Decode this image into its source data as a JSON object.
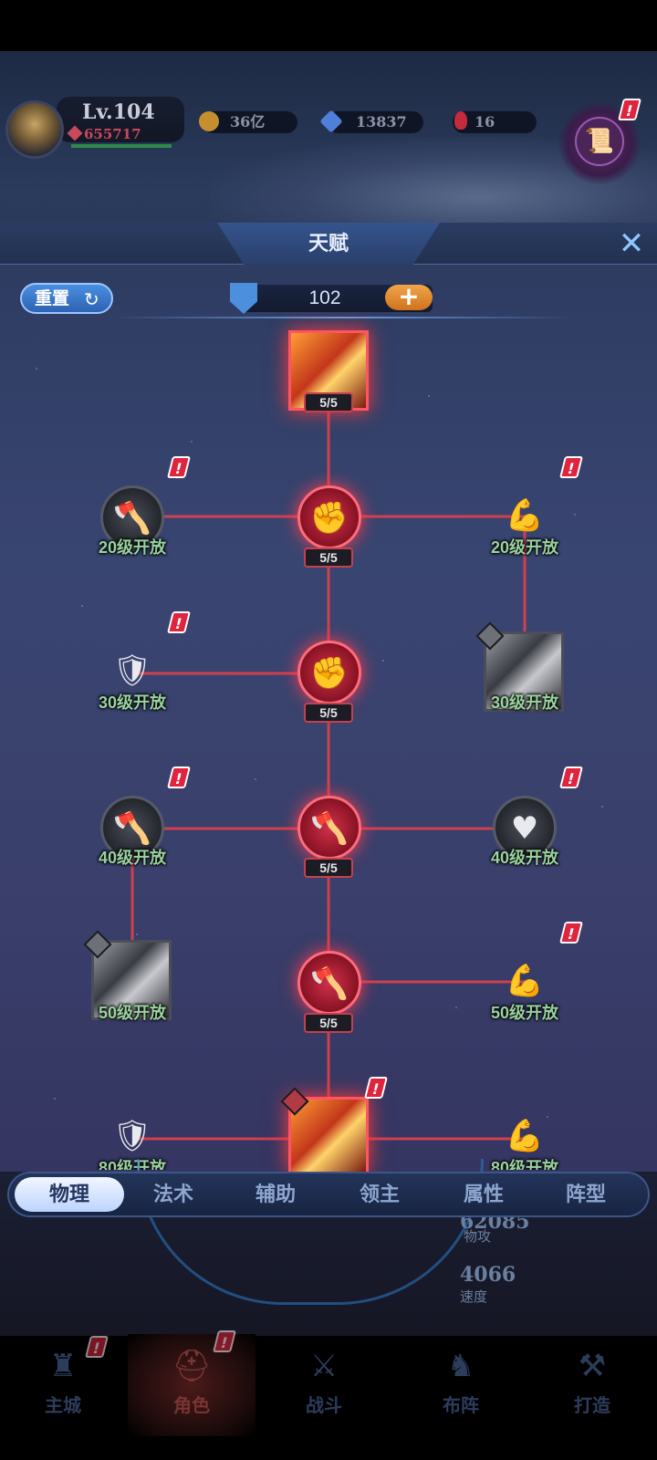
{
  "header": {
    "level": "Lv.104",
    "power": "655717",
    "resources": [
      {
        "name": "gold",
        "value": "36亿",
        "color": "#d4a13c"
      },
      {
        "name": "diamond",
        "value": "13837",
        "color": "#5e8fe6"
      },
      {
        "name": "ruby",
        "value": "16",
        "color": "#d0324a"
      }
    ],
    "notice_badge": "!"
  },
  "panel": {
    "title": "天赋",
    "reset_label": "重置",
    "talent_points": "102",
    "add_label": "+",
    "close_label": "✕"
  },
  "tree": {
    "top_level": "5/5",
    "spine_levels": [
      "5/5",
      "5/5",
      "5/5",
      "5/5"
    ],
    "locked_labels": {
      "left_20": "20级开放",
      "right_20": "20级开放",
      "left_30": "30级开放",
      "right_30": "30级开放",
      "left_40": "40级开放",
      "right_40": "40级开放",
      "left_50": "50级开放",
      "right_50": "50级开放",
      "left_80": "80级开放",
      "right_80": "80级开放"
    },
    "badge": "!"
  },
  "tabs": [
    "物理",
    "法术",
    "辅助",
    "领主",
    "属性",
    "阵型"
  ],
  "active_tab": "物理",
  "background_stats": [
    {
      "value": "62085",
      "label": "物攻"
    },
    {
      "value": "4066",
      "label": "速度"
    }
  ],
  "bottom_nav": [
    {
      "label": "主城",
      "icon": "castle-icon"
    },
    {
      "label": "角色",
      "icon": "helmet-icon"
    },
    {
      "label": "战斗",
      "icon": "crossed-swords-icon"
    },
    {
      "label": "布阵",
      "icon": "formation-icon"
    },
    {
      "label": "打造",
      "icon": "anvil-icon"
    }
  ],
  "colors": {
    "accent_red": "#d2314a",
    "accent_blue": "#4a8ee0",
    "locked_label": "#9ad2a0"
  }
}
